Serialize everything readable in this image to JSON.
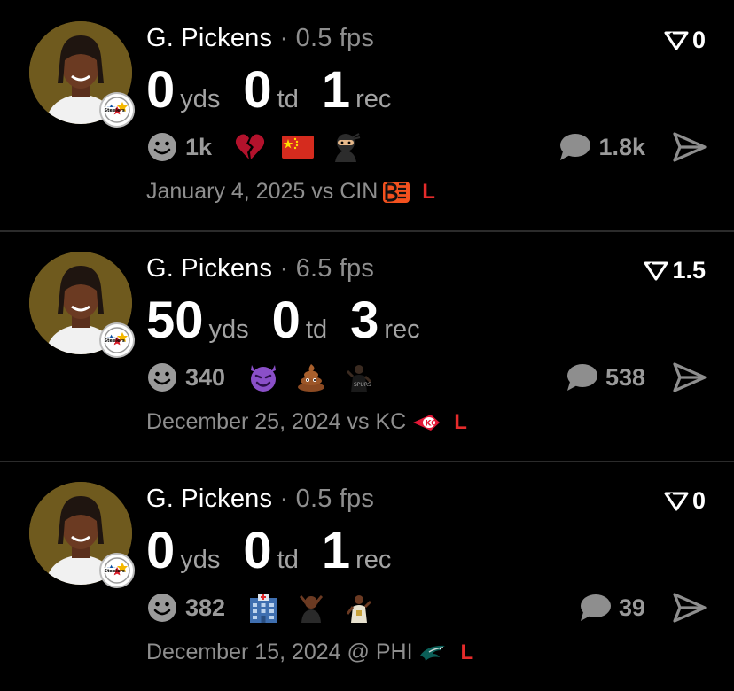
{
  "feed": {
    "posts": [
      {
        "player": "G. Pickens",
        "separator": "·",
        "fps": "0.5 fps",
        "line_value": "0",
        "stats": [
          {
            "value": "0",
            "unit": "yds"
          },
          {
            "value": "0",
            "unit": "td"
          },
          {
            "value": "1",
            "unit": "rec"
          }
        ],
        "reaction_count": "1k",
        "reaction_emojis": [
          "broken-heart-emoji",
          "china-flag-emoji",
          "ninja-emoji"
        ],
        "comment_count": "1.8k",
        "date": "January 4, 2025",
        "matchup": "vs CIN",
        "opponent_logo": "bengals-logo",
        "result": "L"
      },
      {
        "player": "G. Pickens",
        "separator": "·",
        "fps": "6.5 fps",
        "line_value": "1.5",
        "stats": [
          {
            "value": "50",
            "unit": "yds"
          },
          {
            "value": "0",
            "unit": "td"
          },
          {
            "value": "3",
            "unit": "rec"
          }
        ],
        "reaction_count": "340",
        "reaction_emojis": [
          "smiling-devil-emoji",
          "poop-emoji",
          "player-photo-emoji"
        ],
        "comment_count": "538",
        "date": "December 25, 2024",
        "matchup": "vs KC",
        "opponent_logo": "chiefs-logo",
        "result": "L"
      },
      {
        "player": "G. Pickens",
        "separator": "·",
        "fps": "0.5 fps",
        "line_value": "0",
        "stats": [
          {
            "value": "0",
            "unit": "yds"
          },
          {
            "value": "0",
            "unit": "td"
          },
          {
            "value": "1",
            "unit": "rec"
          }
        ],
        "reaction_count": "382",
        "reaction_emojis": [
          "hospital-emoji",
          "facepalm-person-emoji",
          "player-photo-emoji"
        ],
        "comment_count": "39",
        "date": "December 15, 2024",
        "matchup": "@ PHI",
        "opponent_logo": "eagles-logo",
        "result": "L"
      }
    ]
  },
  "colors": {
    "background": "#000000",
    "muted_text": "#8e8e8e",
    "loss_red": "#e52b2b",
    "avatar_bg": "#6f5a1e"
  },
  "icons": {
    "line": "line-filter-icon",
    "reaction": "smiley-face-icon",
    "comment": "chat-bubble-icon",
    "share": "send-arrow-icon",
    "team_badge": "steelers-logo"
  }
}
